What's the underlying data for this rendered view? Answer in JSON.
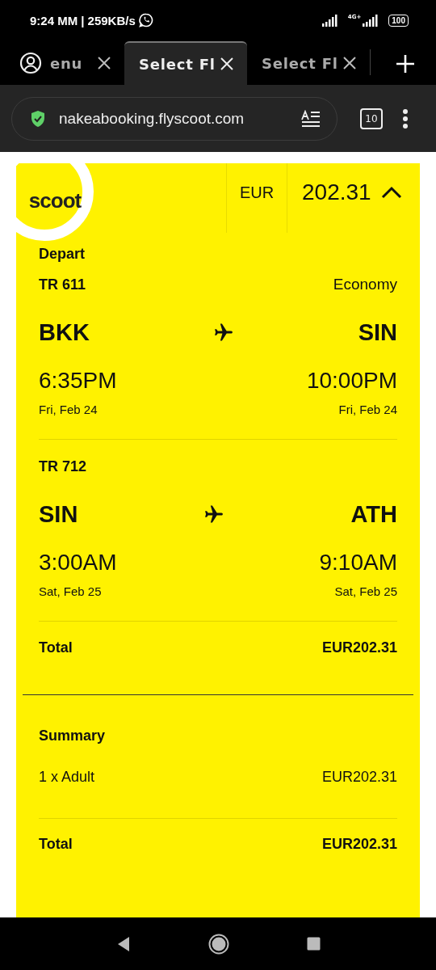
{
  "status_bar": {
    "time": "9:24 MM",
    "speed": "| 259KB/s",
    "battery": "100",
    "network": "4G+"
  },
  "browser_tabs": [
    {
      "label": "enu",
      "selected": false
    },
    {
      "label": "Select Fl",
      "selected": true
    },
    {
      "label": "Select Fl",
      "selected": false
    }
  ],
  "address_bar": {
    "url": "nakeabooking.flyscoot.com",
    "tab_count": "10"
  },
  "header": {
    "logo": "scoot",
    "currency": "EUR",
    "price": "202.31",
    "expanded": true
  },
  "section_title": "Depart",
  "flights": [
    {
      "number": "TR 611",
      "cabin": "Economy",
      "from": "BKK",
      "to": "SIN",
      "depart_time": "6:35PM",
      "depart_date": "Fri, Feb 24",
      "arrive_time": "10:00PM",
      "arrive_date": "Fri, Feb 24"
    },
    {
      "number": "TR 712",
      "from": "SIN",
      "to": "ATH",
      "depart_time": "3:00AM",
      "depart_date": "Sat, Feb 25",
      "arrive_time": "9:10AM",
      "arrive_date": "Sat, Feb 25"
    }
  ],
  "flight_total": {
    "label": "Total",
    "value": "EUR202.31"
  },
  "summary": {
    "title": "Summary",
    "lines": [
      {
        "label": "1 x Adult",
        "value": "EUR202.31"
      }
    ],
    "total": {
      "label": "Total",
      "value": "EUR202.31"
    }
  }
}
